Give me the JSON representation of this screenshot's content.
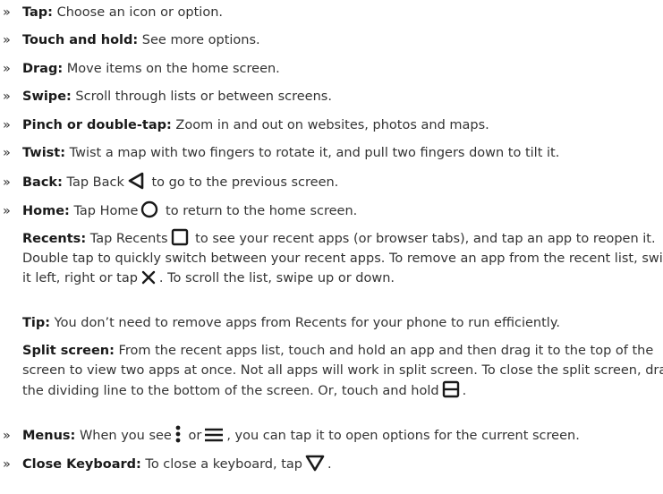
{
  "bullet": "»",
  "items": [
    {
      "term": "Tap:",
      "text": " Choose an icon or option."
    },
    {
      "term": "Touch and hold:",
      "text": " See more options."
    },
    {
      "term": "Drag:",
      "text": " Move items on the home screen."
    },
    {
      "term": "Swipe:",
      "text": " Scroll through lists or between screens."
    },
    {
      "term": "Pinch or double-tap:",
      "text": " Zoom in and out on websites, photos and maps."
    },
    {
      "term": "Twist:",
      "text": " Twist a map with two fingers to rotate it, and pull two fingers down to tilt it."
    },
    {
      "term": "Back:",
      "pre": " Tap Back",
      "post": " to go to the previous screen."
    },
    {
      "term": "Home:",
      "pre": " Tap Home",
      "post": " to return to the home screen."
    },
    {
      "term": "Recents:",
      "pre": " Tap Recents",
      "post": " to see your recent apps (or browser tabs), and tap an app to reopen it. Double tap to quickly switch between your recent apps. To remove an app from the recent list, swipe it left, right or tap",
      "post2": ". To scroll the list, swipe up or down."
    },
    {
      "term": "Split screen:",
      "pre": " From the recent apps list, touch and hold an app and then drag it to the top of the screen to view two apps at once. Not all apps will work in split screen. To close the split screen, drag the dividing line to the bottom of the screen. Or, touch and hold",
      "post": "."
    },
    {
      "term": "Menus:",
      "pre": " When you see",
      "mid": " or",
      "post": ", you can tap it to open options for the current screen."
    },
    {
      "term": "Close Keyboard:",
      "pre": " To close a keyboard, tap",
      "post": "."
    }
  ],
  "tip": {
    "term": "Tip:",
    "text": " You don’t need to remove apps from Recents for your phone to run efficiently."
  },
  "icons": {
    "back": "back-triangle-icon",
    "home": "home-circle-icon",
    "recents": "recents-square-icon",
    "close": "close-x-icon",
    "split": "split-screen-icon",
    "menu_dots": "vertical-dots-icon",
    "menu_lines": "hamburger-menu-icon",
    "keyboard": "close-keyboard-triangle-icon"
  }
}
